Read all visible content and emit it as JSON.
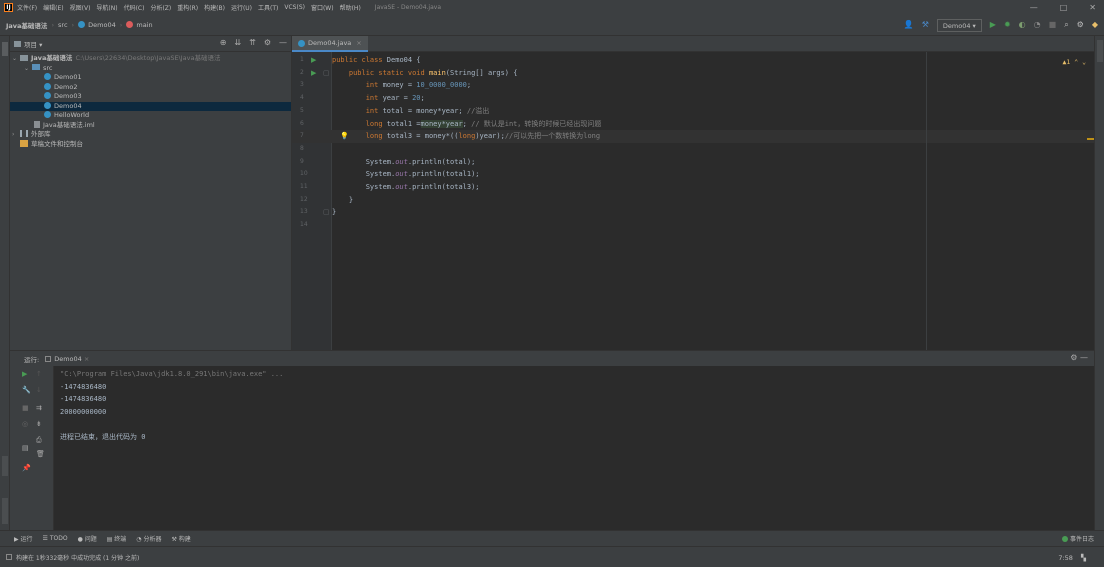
{
  "titlebar": {
    "logo": "IJ",
    "menus": [
      "文件(F)",
      "编辑(E)",
      "视图(V)",
      "导航(N)",
      "代码(C)",
      "分析(Z)",
      "重构(R)",
      "构建(B)",
      "运行(U)",
      "工具(T)",
      "VCS(S)",
      "窗口(W)",
      "帮助(H)"
    ],
    "window_title": "JavaSE - Demo04.java",
    "min": "—",
    "max": "□",
    "close": "✕"
  },
  "navbar": {
    "crumbs": [
      "Java基础语法",
      "src",
      "Demo04",
      "main"
    ],
    "run_config": "Demo04 ▾"
  },
  "project": {
    "header": "项目 ▾",
    "root_label": "Java基础语法",
    "root_path": "C:\\Users\\22634\\Desktop\\JavaSE\\Java基础语法",
    "src_label": "src",
    "classes": [
      "Demo01",
      "Demo2",
      "Demo03",
      "Demo04",
      "HelloWorld"
    ],
    "iml": "Java基础语法.iml",
    "external_libs": "外部库",
    "scratches": "草稿文件和控制台"
  },
  "editor": {
    "tab_label": "Demo04.java",
    "line_numbers": [
      "1",
      "2",
      "3",
      "4",
      "5",
      "6",
      "7",
      "8",
      "9",
      "10",
      "11",
      "12",
      "13",
      "14"
    ],
    "warnings": "▲1"
  },
  "run": {
    "header_label": "运行:",
    "tab_label": "Demo04",
    "output": [
      "\"C:\\Program Files\\Java\\jdk1.8.0_291\\bin\\java.exe\" ...",
      "-1474836480",
      "-1474836480",
      "20000000000",
      "",
      "进程已结束，退出代码为 0"
    ]
  },
  "bottom_tools": [
    "▶ 运行",
    "☰ TODO",
    "● 问题",
    "▤ 终端",
    "◔ 分析器",
    "⚒ 构建"
  ],
  "event_log": "事件日志",
  "status": {
    "message": "构建在 1秒332毫秒 中成功完成 (1 分钟 之前)",
    "time": "7:58"
  },
  "colors": {
    "keyword": "#cc7832",
    "number": "#6897bb",
    "comment": "#808080",
    "method": "#ffc66d",
    "static_field": "#9876aa",
    "background": "#2b2b2b"
  }
}
